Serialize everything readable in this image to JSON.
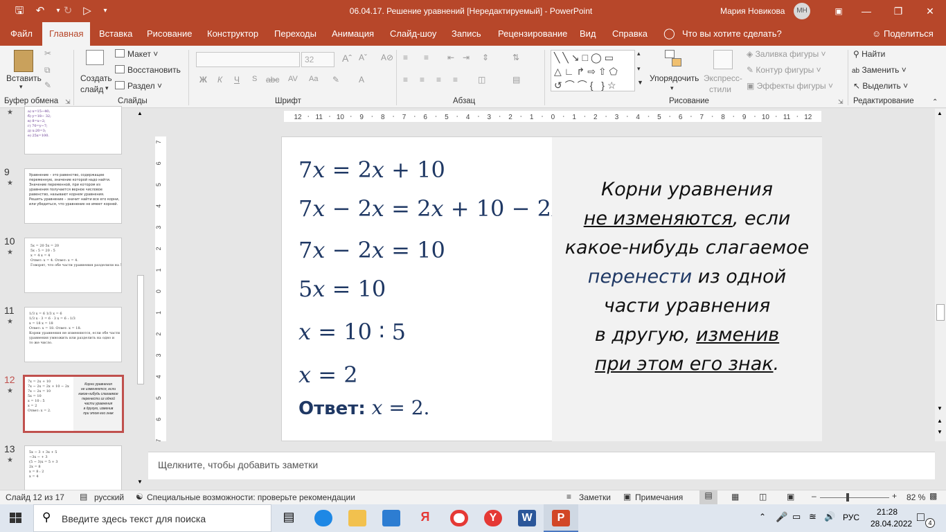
{
  "window": {
    "title": "06.04.17. Решение уравнений [Нередактируемый]  -  PowerPoint",
    "user": "Мария Новикова",
    "initials": "МН"
  },
  "menu": {
    "tabs": [
      "Файл",
      "Главная",
      "Вставка",
      "Рисование",
      "Конструктор",
      "Переходы",
      "Анимация",
      "Слайд-шоу",
      "Запись",
      "Рецензирование",
      "Вид",
      "Справка"
    ],
    "tell_me": "Что вы хотите сделать?",
    "share": "Поделиться"
  },
  "ribbon": {
    "paste": "Вставить",
    "create_slide_1": "Создать",
    "create_slide_2": "слайд",
    "layout": "Макет",
    "reset": "Восстановить",
    "section": "Раздел",
    "font_size": "32",
    "arrange": "Упорядочить",
    "express_1": "Экспресс-",
    "express_2": "стили",
    "shape_fill": "Заливка фигуры",
    "shape_outline": "Контур фигуры",
    "shape_effects": "Эффекты фигуры",
    "find": "Найти",
    "replace": "Заменить",
    "select": "Выделить",
    "groups": {
      "clipboard": "Буфер обмена",
      "slides": "Слайды",
      "font": "Шрифт",
      "paragraph": "Абзац",
      "drawing": "Рисование",
      "editing": "Редактирование"
    }
  },
  "ruler": {
    "h_ticks": [
      "12",
      "11",
      "10",
      "9",
      "8",
      "7",
      "6",
      "5",
      "4",
      "3",
      "2",
      "1",
      "0",
      "1",
      "2",
      "3",
      "4",
      "5",
      "6",
      "7",
      "8",
      "9",
      "10",
      "11",
      "12"
    ],
    "v_ticks": [
      "7",
      "6",
      "5",
      "4",
      "3",
      "2",
      "1",
      "0",
      "1",
      "2",
      "3",
      "4",
      "5",
      "6",
      "7"
    ]
  },
  "thumbnails": [
    {
      "num": "",
      "lines": [
        "а) x=15−40;",
        "б) y=18− 32;",
        "в) 8=x−2;",
        "г) 70=y−7;",
        "д) x:20=3;",
        "е) 25x=100."
      ]
    },
    {
      "num": "9",
      "lines": [
        "Уравнение – это равенство, содержащее",
        "переменную, значение которой надо найти.",
        "Значение переменной, при котором из",
        "уравнения получается верное числовое",
        "равенство, называют корнем уравнения.",
        "Решить уравнение – значит найти все его корни,",
        "или убедиться, что уравнение не имеет корней."
      ]
    },
    {
      "num": "10",
      "lines": [
        "5x = 20            5x = 20",
        "                    5x : 5 = 20 : 5",
        "x = 4               x = 4",
        "Ответ: x = 4.      Ответ: x = 4.",
        "Говорят, что обе части уравнения разделили на 5."
      ]
    },
    {
      "num": "11",
      "lines": [
        "1/3 x = 6              1/3 x = 6",
        "1/3 x · 3 = 6 · 3      x = 6 : 1/3",
        "x = 18                 x = 18",
        "Ответ: x = 18.        Ответ: x = 18.",
        "Корни уравнения не изменяются, если обе части",
        "уравнения умножить или разделить на одно и",
        "то же число."
      ]
    },
    {
      "num": "12",
      "lines": [
        "7x = 2x + 10",
        "7x − 2x = 2x + 10 − 2x",
        "7x − 2x = 10",
        "5x = 10",
        "x = 10 : 5",
        "x = 2",
        "Ответ: x = 2."
      ]
    },
    {
      "num": "13",
      "lines": [
        "5x − 3 + 3x + 5",
        "   −3x −    + 3",
        "(5 − 3)x = 5 + 3",
        "   2x = 8",
        "   x = 8 : 2",
        "   x = 4"
      ]
    }
  ],
  "slide": {
    "equations": [
      {
        "id": "eq1",
        "text": "7𝑥 = 2𝑥 + 10"
      },
      {
        "id": "eq2",
        "text": "7𝑥 − 2𝑥 = 2𝑥 + 10 − 2𝑥"
      },
      {
        "id": "eq3",
        "text": "7𝑥 − 2𝑥 = 10"
      },
      {
        "id": "eq4",
        "text": "5𝑥 = 10"
      },
      {
        "id": "eq5",
        "text": "𝑥 = 10 ∶ 5"
      },
      {
        "id": "eq6",
        "text": "𝑥 = 2"
      }
    ],
    "answer_label": "Ответ:",
    "answer_value": "𝑥 = 2.",
    "rule": {
      "l1": "Корни уравнения",
      "l2a": "не изменяются",
      "l2b": ", если",
      "l3": "какое-нибудь слагаемое",
      "l4a": "перенести",
      "l4b": " из одной",
      "l5": "части уравнения",
      "l6a": "в другую, ",
      "l6b": "изменив ",
      "l7a": "при этом его знак",
      "l7b": "."
    },
    "accent_color": "#1f3864"
  },
  "notes_placeholder": "Щелкните, чтобы добавить заметки",
  "status": {
    "slide": "Слайд 12 из 17",
    "language": "русский",
    "accessibility": "Специальные возможности: проверьте рекомендации",
    "notes": "Заметки",
    "comments": "Примечания",
    "zoom": "82 %"
  },
  "taskbar": {
    "search": "Введите здесь текст для поиска",
    "lang": "РУС",
    "time": "21:28",
    "date": "28.04.2022",
    "badge": "4"
  },
  "colors": {
    "brand": "#b7472a",
    "selected_thumb": "#c0504d"
  }
}
